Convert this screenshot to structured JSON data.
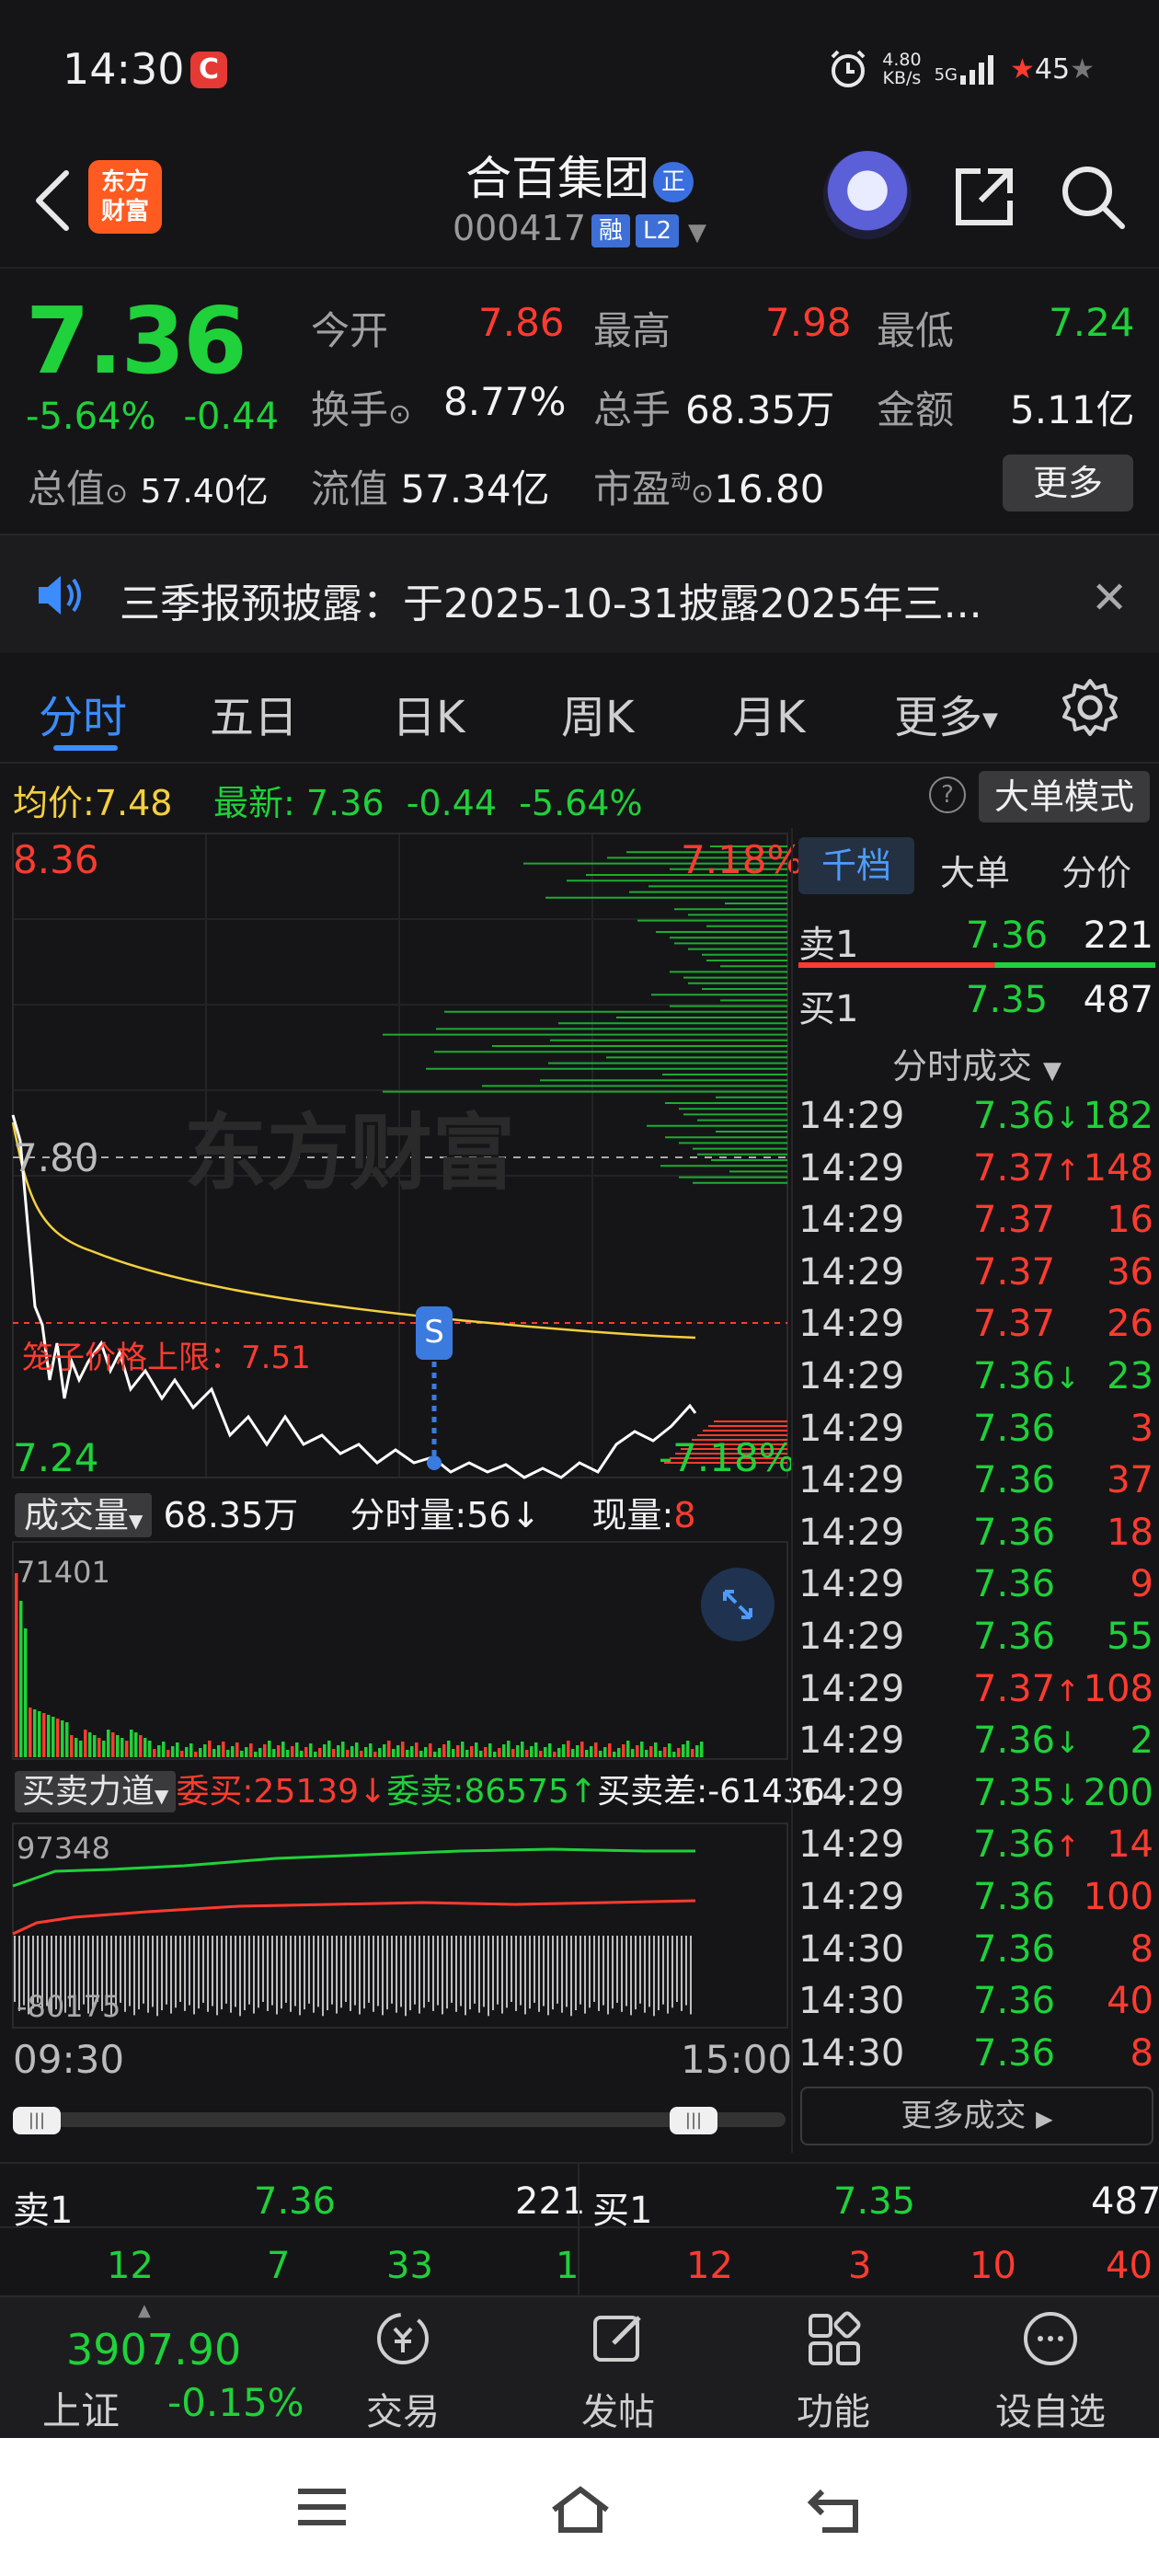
{
  "status_bar": {
    "time": "14:30",
    "app_badge": "C",
    "net_speed_value": "4.80",
    "net_speed_unit": "KB/s",
    "network": "5G",
    "battery": "45"
  },
  "header": {
    "logo_line1": "东方",
    "logo_line2": "财富",
    "stock_name": "合百集团",
    "name_badge": "正",
    "stock_code": "000417",
    "tag_margin": "融",
    "tag_level": "L2"
  },
  "quote": {
    "price": "7.36",
    "change_pct": "-5.64%",
    "change_abs": "-0.44",
    "open_label": "今开",
    "open_value": "7.86",
    "high_label": "最高",
    "high_value": "7.98",
    "low_label": "最低",
    "low_value": "7.24",
    "turnover_label": "换手",
    "turnover_value": "8.77%",
    "volume_label": "总手",
    "volume_value": "68.35万",
    "amount_label": "金额",
    "amount_value": "5.11亿",
    "mcap_label": "总值",
    "mcap_value": "57.40亿",
    "float_label": "流值",
    "float_value": "57.34亿",
    "pe_label": "市盈",
    "pe_sup": "动",
    "pe_value": "16.80",
    "more_button": "更多"
  },
  "notice": {
    "text": "三季报预披露：于2025-10-31披露2025年三...",
    "close": "✕"
  },
  "tabs": [
    {
      "label": "分时"
    },
    {
      "label": "五日"
    },
    {
      "label": "日K"
    },
    {
      "label": "周K"
    },
    {
      "label": "月K"
    },
    {
      "label": "更多"
    }
  ],
  "info_row": {
    "avg_label": "均价:",
    "avg_value": "7.48",
    "latest_label": "最新:",
    "latest_value": "7.36",
    "latest_change": "-0.44",
    "latest_pct": "-5.64%",
    "help": "?",
    "mode_button": "大单模式"
  },
  "chart": {
    "price_top": "8.36",
    "pct_top": "7.18%",
    "price_mid": "7.80",
    "price_bottom": "7.24",
    "pct_bottom": "-7.18%",
    "cage_limit": "笼子价格上限：7.51",
    "marker": "S",
    "watermark": "东方财富",
    "volume_label": "成交量",
    "volume_total": "68.35万",
    "minute_volume": "分时量:56",
    "current_volume_label": "现量:",
    "current_volume": "8",
    "volume_max": "71401",
    "force_label": "买卖力道",
    "bid_committed": "委买:25139",
    "ask_committed": "委卖:86575",
    "bid_ask_diff": "买卖差:-61436",
    "force_top": "97348",
    "force_bottom": "-80175",
    "time_start": "09:30",
    "time_end": "15:00",
    "colors": {
      "price_line": "#ffffff",
      "avg_line": "#f4d03f",
      "up": "#ff3b30",
      "down": "#1fd13a"
    }
  },
  "right_panel": {
    "tabs": [
      "千档",
      "大单",
      "分价"
    ],
    "ask1_label": "卖1",
    "ask1_price": "7.36",
    "ask1_vol": "221",
    "bid1_label": "买1",
    "bid1_price": "7.35",
    "bid1_vol": "487",
    "trades_title": "分时成交",
    "trades": [
      {
        "time": "14:29",
        "price": "7.36",
        "arrow": "↓",
        "vol": "182",
        "side": "down"
      },
      {
        "time": "14:29",
        "price": "7.37",
        "arrow": "↑",
        "vol": "148",
        "side": "up"
      },
      {
        "time": "14:29",
        "price": "7.37",
        "arrow": "",
        "vol": "16",
        "side": "up"
      },
      {
        "time": "14:29",
        "price": "7.37",
        "arrow": "",
        "vol": "36",
        "side": "up"
      },
      {
        "time": "14:29",
        "price": "7.37",
        "arrow": "",
        "vol": "26",
        "side": "up"
      },
      {
        "time": "14:29",
        "price": "7.36",
        "arrow": "↓",
        "vol": "23",
        "side": "down"
      },
      {
        "time": "14:29",
        "price": "7.36",
        "arrow": "",
        "vol": "3",
        "side": "up"
      },
      {
        "time": "14:29",
        "price": "7.36",
        "arrow": "",
        "vol": "37",
        "side": "up"
      },
      {
        "time": "14:29",
        "price": "7.36",
        "arrow": "",
        "vol": "18",
        "side": "up"
      },
      {
        "time": "14:29",
        "price": "7.36",
        "arrow": "",
        "vol": "9",
        "side": "up"
      },
      {
        "time": "14:29",
        "price": "7.36",
        "arrow": "",
        "vol": "55",
        "side": "down"
      },
      {
        "time": "14:29",
        "price": "7.37",
        "arrow": "↑",
        "vol": "108",
        "side": "up"
      },
      {
        "time": "14:29",
        "price": "7.36",
        "arrow": "↓",
        "vol": "2",
        "side": "down"
      },
      {
        "time": "14:29",
        "price": "7.35",
        "arrow": "↓",
        "vol": "200",
        "side": "down"
      },
      {
        "time": "14:29",
        "price": "7.36",
        "arrow": "↑",
        "vol": "14",
        "side": "up"
      },
      {
        "time": "14:29",
        "price": "7.36",
        "arrow": "",
        "vol": "100",
        "side": "up"
      },
      {
        "time": "14:30",
        "price": "7.36",
        "arrow": "",
        "vol": "8",
        "side": "up"
      },
      {
        "time": "14:30",
        "price": "7.36",
        "arrow": "",
        "vol": "40",
        "side": "up"
      },
      {
        "time": "14:30",
        "price": "7.36",
        "arrow": "",
        "vol": "8",
        "side": "up"
      }
    ],
    "more_trades": "更多成交"
  },
  "order_book": {
    "ask_label": "卖1",
    "ask_price": "7.36",
    "ask_vol": "221",
    "bid_label": "买1",
    "bid_price": "7.35",
    "bid_vol": "487",
    "ask_breakdown": [
      "12",
      "7",
      "33",
      "1"
    ],
    "bid_breakdown": [
      "12",
      "3",
      "10",
      "40"
    ]
  },
  "bottom_nav": {
    "index_value": "3907.90",
    "index_name": "上证",
    "index_change": "-0.15%",
    "items": [
      {
        "label": "交易",
        "icon": "trade-icon"
      },
      {
        "label": "发帖",
        "icon": "post-icon"
      },
      {
        "label": "功能",
        "icon": "function-icon"
      },
      {
        "label": "设自选",
        "icon": "watchlist-icon"
      }
    ]
  }
}
